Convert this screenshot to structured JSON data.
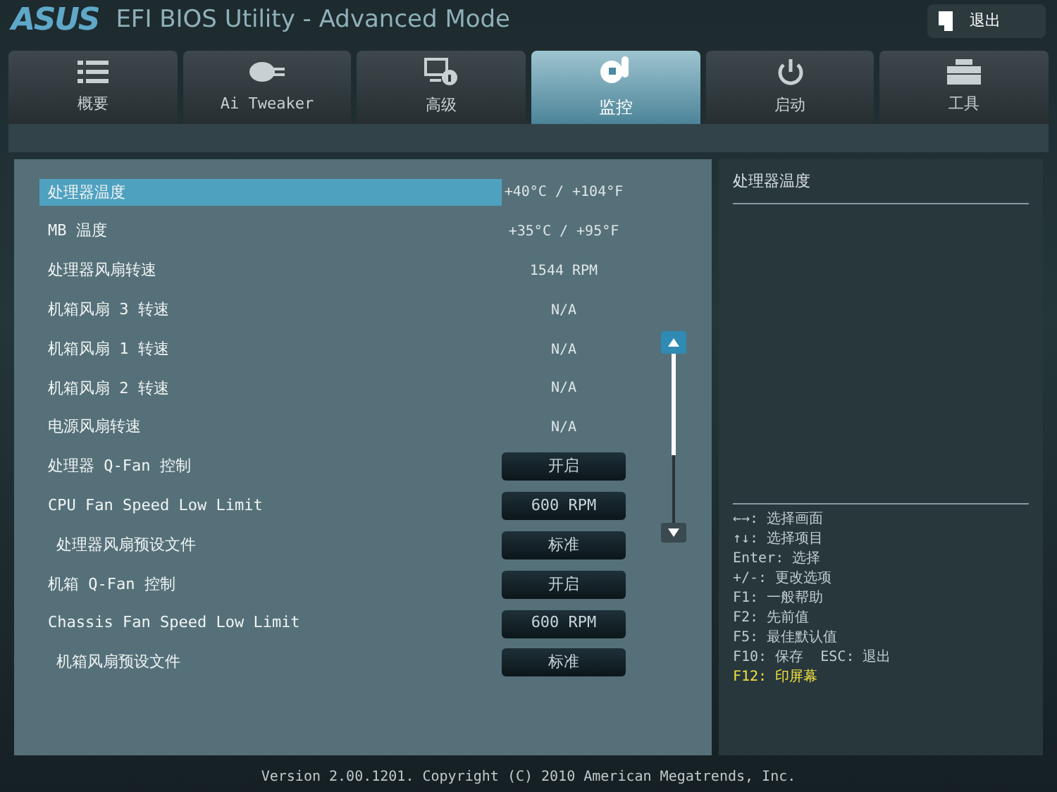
{
  "header": {
    "logo": "ASUS",
    "title": "EFI BIOS Utility - Advanced Mode",
    "exit_button": "退出"
  },
  "tabs": [
    {
      "label": "概要",
      "selected": false
    },
    {
      "label": "Ai Tweaker",
      "selected": false
    },
    {
      "label": "高级",
      "selected": false
    },
    {
      "label": "监控",
      "selected": true
    },
    {
      "label": "启动",
      "selected": false
    },
    {
      "label": "工具",
      "selected": false
    }
  ],
  "settings": [
    {
      "kind": "reading",
      "label": "处理器温度",
      "value": "+40°C / +104°F",
      "selected": true,
      "indented": false
    },
    {
      "kind": "reading",
      "label": "MB 温度",
      "value": "+35°C / +95°F",
      "selected": false,
      "indented": false
    },
    {
      "kind": "reading",
      "label": "处理器风扇转速",
      "value": "1544 RPM",
      "selected": false,
      "indented": false
    },
    {
      "kind": "reading",
      "label": "机箱风扇 3 转速",
      "value": "N/A",
      "selected": false,
      "indented": false
    },
    {
      "kind": "reading",
      "label": "机箱风扇 1 转速",
      "value": "N/A",
      "selected": false,
      "indented": false
    },
    {
      "kind": "reading",
      "label": "机箱风扇 2 转速",
      "value": "N/A",
      "selected": false,
      "indented": false
    },
    {
      "kind": "reading",
      "label": "电源风扇转速",
      "value": "N/A",
      "selected": false,
      "indented": false
    },
    {
      "kind": "option",
      "label": "处理器 Q-Fan 控制",
      "value": "开启",
      "selected": false,
      "indented": false
    },
    {
      "kind": "option",
      "label": "CPU Fan Speed Low Limit",
      "value": "600 RPM",
      "selected": false,
      "indented": false
    },
    {
      "kind": "option",
      "label": "处理器风扇预设文件",
      "value": "标准",
      "selected": false,
      "indented": true
    },
    {
      "kind": "option",
      "label": "机箱 Q-Fan 控制",
      "value": "开启",
      "selected": false,
      "indented": false
    },
    {
      "kind": "option",
      "label": "Chassis Fan Speed Low Limit",
      "value": "600 RPM",
      "selected": false,
      "indented": false
    },
    {
      "kind": "option",
      "label": "机箱风扇预设文件",
      "value": "标准",
      "selected": false,
      "indented": true
    }
  ],
  "help": {
    "description": "处理器温度",
    "keys": [
      {
        "text": "←→: 选择画面",
        "highlighted": false
      },
      {
        "text": "↑↓: 选择项目",
        "highlighted": false
      },
      {
        "text": "Enter: 选择",
        "highlighted": false
      },
      {
        "text": "+/-: 更改选项",
        "highlighted": false
      },
      {
        "text": "F1: 一般帮助",
        "highlighted": false
      },
      {
        "text": "F2: 先前值",
        "highlighted": false
      },
      {
        "text": "F5: 最佳默认值",
        "highlighted": false
      },
      {
        "text": "F10: 保存  ESC: 退出",
        "highlighted": false
      },
      {
        "text": "F12: 印屏幕",
        "highlighted": true
      }
    ]
  },
  "footer": "Version 2.00.1201. Copyright (C) 2010 American Megatrends, Inc."
}
